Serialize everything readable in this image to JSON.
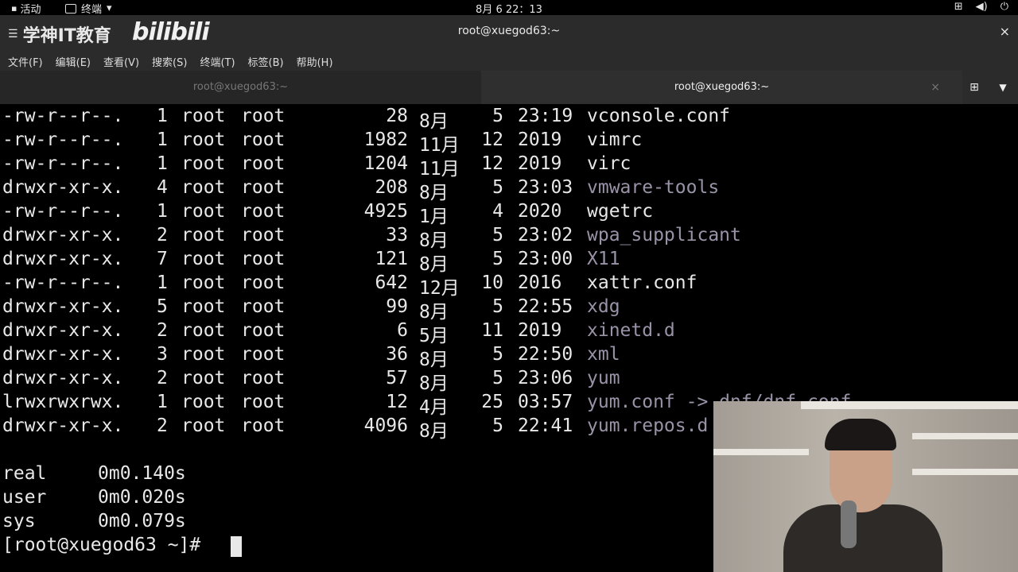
{
  "topbar": {
    "activities": "活动",
    "app_name": "终端",
    "app_arrow": "▾",
    "clock": "8月 6  22：13",
    "tray_icons": [
      "network-icon",
      "volume-icon",
      "power-icon"
    ]
  },
  "window": {
    "logo_text": "学神IT教育",
    "brand_text": "bilibili",
    "title": "root@xuegod63:~",
    "close": "×"
  },
  "menubar": [
    "文件(F)",
    "编辑(E)",
    "查看(V)",
    "搜索(S)",
    "终端(T)",
    "标签(B)",
    "帮助(H)"
  ],
  "tabs": [
    {
      "label": "root@xuegod63:~",
      "active": false
    },
    {
      "label": "root@xuegod63:~",
      "active": true
    }
  ],
  "tab_close": "×",
  "listing": [
    {
      "perm": "-rw-r--r--.",
      "links": "1",
      "owner": "root",
      "group": "root",
      "size": "28",
      "month": "8月",
      "day": "5",
      "time": "23:19",
      "name": "vconsole.conf",
      "is_dir": false
    },
    {
      "perm": "-rw-r--r--.",
      "links": "1",
      "owner": "root",
      "group": "root",
      "size": "1982",
      "month": "11月",
      "day": "12",
      "time": "2019",
      "name": "vimrc",
      "is_dir": false
    },
    {
      "perm": "-rw-r--r--.",
      "links": "1",
      "owner": "root",
      "group": "root",
      "size": "1204",
      "month": "11月",
      "day": "12",
      "time": "2019",
      "name": "virc",
      "is_dir": false
    },
    {
      "perm": "drwxr-xr-x.",
      "links": "4",
      "owner": "root",
      "group": "root",
      "size": "208",
      "month": "8月",
      "day": "5",
      "time": "23:03",
      "name": "vmware-tools",
      "is_dir": true
    },
    {
      "perm": "-rw-r--r--.",
      "links": "1",
      "owner": "root",
      "group": "root",
      "size": "4925",
      "month": "1月",
      "day": "4",
      "time": "2020",
      "name": "wgetrc",
      "is_dir": false
    },
    {
      "perm": "drwxr-xr-x.",
      "links": "2",
      "owner": "root",
      "group": "root",
      "size": "33",
      "month": "8月",
      "day": "5",
      "time": "23:02",
      "name": "wpa_supplicant",
      "is_dir": true
    },
    {
      "perm": "drwxr-xr-x.",
      "links": "7",
      "owner": "root",
      "group": "root",
      "size": "121",
      "month": "8月",
      "day": "5",
      "time": "23:00",
      "name": "X11",
      "is_dir": true
    },
    {
      "perm": "-rw-r--r--.",
      "links": "1",
      "owner": "root",
      "group": "root",
      "size": "642",
      "month": "12月",
      "day": "10",
      "time": "2016",
      "name": "xattr.conf",
      "is_dir": false
    },
    {
      "perm": "drwxr-xr-x.",
      "links": "5",
      "owner": "root",
      "group": "root",
      "size": "99",
      "month": "8月",
      "day": "5",
      "time": "22:55",
      "name": "xdg",
      "is_dir": true
    },
    {
      "perm": "drwxr-xr-x.",
      "links": "2",
      "owner": "root",
      "group": "root",
      "size": "6",
      "month": "5月",
      "day": "11",
      "time": "2019",
      "name": "xinetd.d",
      "is_dir": true
    },
    {
      "perm": "drwxr-xr-x.",
      "links": "3",
      "owner": "root",
      "group": "root",
      "size": "36",
      "month": "8月",
      "day": "5",
      "time": "22:50",
      "name": "xml",
      "is_dir": true
    },
    {
      "perm": "drwxr-xr-x.",
      "links": "2",
      "owner": "root",
      "group": "root",
      "size": "57",
      "month": "8月",
      "day": "5",
      "time": "23:06",
      "name": "yum",
      "is_dir": true
    },
    {
      "perm": "lrwxrwxrwx.",
      "links": "1",
      "owner": "root",
      "group": "root",
      "size": "12",
      "month": "4月",
      "day": "25",
      "time": "03:57",
      "name": "yum.conf -> dnf/dnf.conf",
      "is_dir": true
    },
    {
      "perm": "drwxr-xr-x.",
      "links": "2",
      "owner": "root",
      "group": "root",
      "size": "4096",
      "month": "8月",
      "day": "5",
      "time": "22:41",
      "name": "yum.repos.d",
      "is_dir": true
    }
  ],
  "timing": [
    {
      "label": "real",
      "value": "0m0.140s"
    },
    {
      "label": "user",
      "value": "0m0.020s"
    },
    {
      "label": "sys",
      "value": "0m0.079s"
    }
  ],
  "prompt": "[root@xuegod63 ~]# "
}
